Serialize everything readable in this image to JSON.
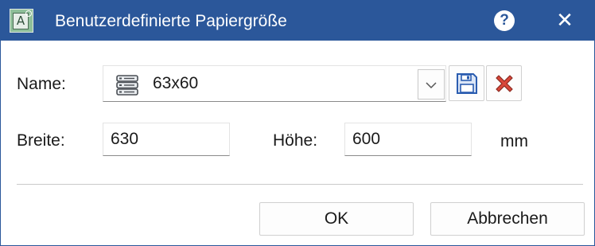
{
  "window": {
    "title": "Benutzerdefinierte Papiergröße",
    "app_icon_letter": "A",
    "help_glyph": "?",
    "close_glyph": "✕"
  },
  "form": {
    "name_label": "Name:",
    "name_value": "63x60",
    "width_label": "Breite:",
    "width_value": "630",
    "height_label": "Höhe:",
    "height_value": "600",
    "unit": "mm"
  },
  "icons": {
    "preset": "database-icon",
    "dropdown": "chevron-down-icon",
    "save": "floppy-disk-icon",
    "delete": "red-x-icon"
  },
  "buttons": {
    "ok": "OK",
    "cancel": "Abbrechen"
  },
  "colors": {
    "titlebar": "#2b579a",
    "save_icon": "#2b5db0",
    "delete_icon": "#d9473a"
  }
}
